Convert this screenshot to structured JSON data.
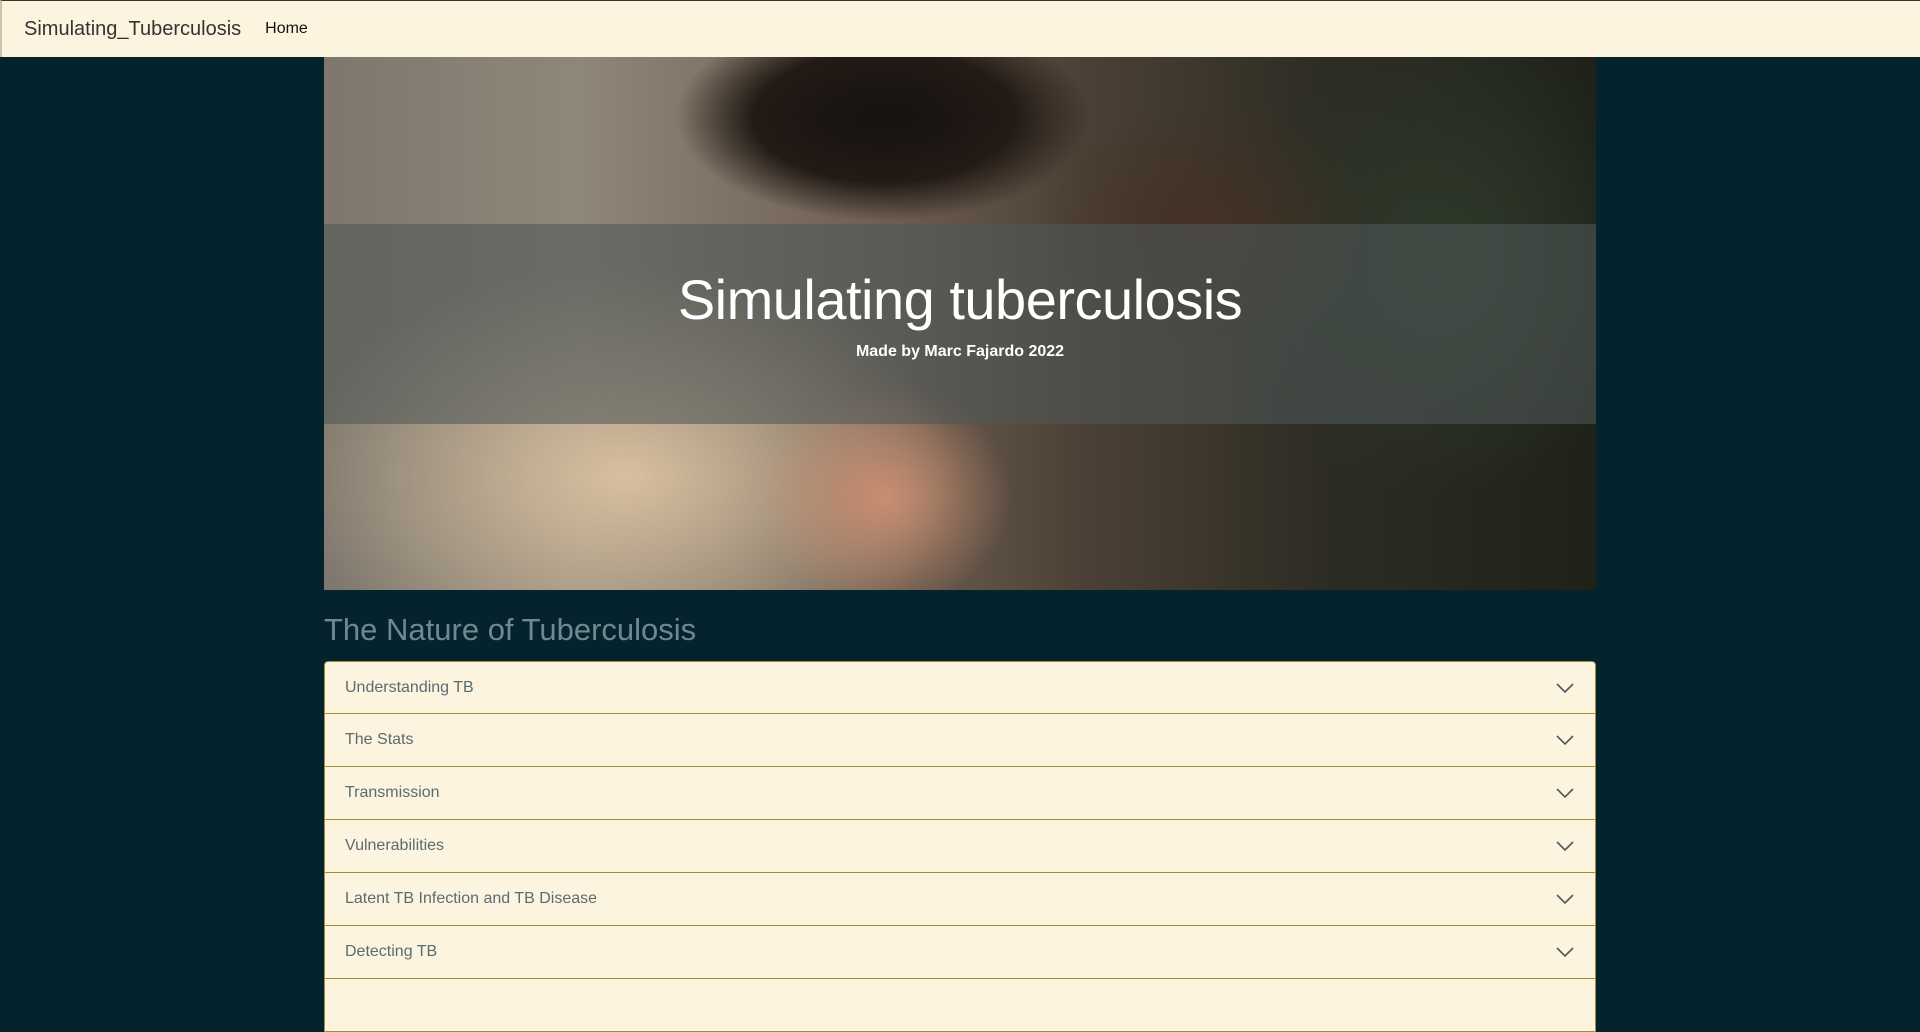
{
  "navbar": {
    "brand": "Simulating_Tuberculosis",
    "links": [
      "Home"
    ]
  },
  "hero": {
    "title": "Simulating tuberculosis",
    "subtitle": "Made by Marc Fajardo 2022"
  },
  "section": {
    "title": "The Nature of Tuberculosis"
  },
  "accordion": {
    "items": [
      "Understanding TB",
      "The Stats",
      "Transmission",
      "Vulnerabilities",
      "Latent TB Infection and TB Disease",
      "Detecting TB",
      ""
    ]
  },
  "colors": {
    "page_background": "#04232d",
    "navbar_background": "#fdf4df",
    "accordion_background": "#fdf4df",
    "accordion_border": "#9b8f3a",
    "section_title": "#6f8891"
  }
}
